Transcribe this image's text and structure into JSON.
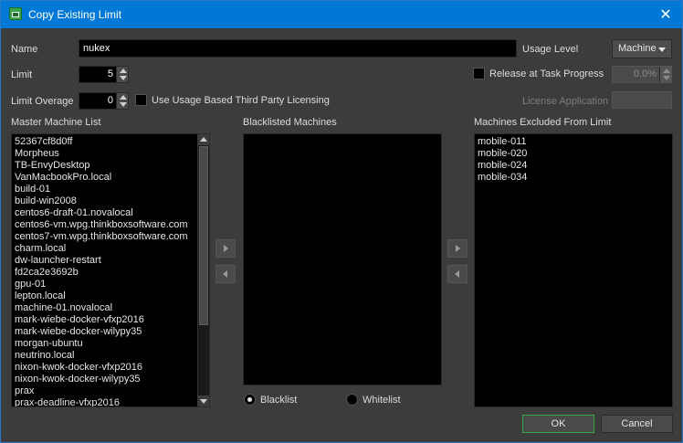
{
  "window": {
    "title": "Copy Existing Limit",
    "close_glyph": "✕",
    "app_icon": "deadline-monitor-icon"
  },
  "form": {
    "name_label": "Name",
    "name_value": "nukex",
    "limit_label": "Limit",
    "limit_value": "5",
    "overage_label": "Limit Overage",
    "overage_value": "0",
    "usage_based_label": "Use Usage Based Third Party Licensing",
    "usage_based_checked": false,
    "usage_level_label": "Usage Level",
    "usage_level_value": "Machine",
    "release_label": "Release at Task Progress",
    "release_checked": false,
    "release_value": "0.0%",
    "license_app_label": "License Application",
    "license_app_value": ""
  },
  "lists": {
    "master_label": "Master Machine List",
    "master_items": [
      "52367cf8d0ff",
      "Morpheus",
      "TB-EnvyDesktop",
      "VanMacbookPro.local",
      "build-01",
      "build-win2008",
      "centos6-draft-01.novalocal",
      "centos6-vm.wpg.thinkboxsoftware.com",
      "centos7-vm.wpg.thinkboxsoftware.com",
      "charm.local",
      "dw-launcher-restart",
      "fd2ca2e3692b",
      "gpu-01",
      "lepton.local",
      "machine-01.novalocal",
      "mark-wiebe-docker-vfxp2016",
      "mark-wiebe-docker-wilypy35",
      "morgan-ubuntu",
      "neutrino.local",
      "nixon-kwok-docker-vfxp2016",
      "nixon-kwok-docker-wilypy35",
      "prax",
      "prax-deadline-vfxp2016"
    ],
    "blacklisted_label": "Blacklisted Machines",
    "blacklisted_items": [],
    "excluded_label": "Machines Excluded From Limit",
    "excluded_items": [
      "mobile-011",
      "mobile-020",
      "mobile-024",
      "mobile-034"
    ]
  },
  "mode": {
    "blacklist_label": "Blacklist",
    "whitelist_label": "Whitelist",
    "selected": "Blacklist"
  },
  "buttons": {
    "ok_label": "OK",
    "cancel_label": "Cancel"
  },
  "colors": {
    "titlebar": "#0078d7",
    "background": "#3c3c3c",
    "default_button_border": "#3aa64a"
  }
}
